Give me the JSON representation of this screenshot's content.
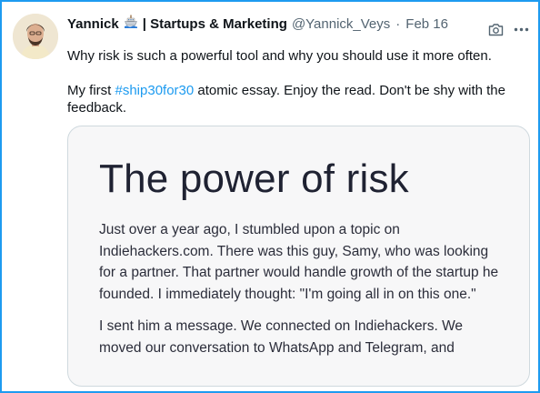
{
  "tweet": {
    "display_name": "Yannick",
    "name_suffix": "| Startups & Marketing",
    "handle": "@Yannick_Veys",
    "separator": "·",
    "date": "Feb 16",
    "text_line1": "Why risk is such a powerful tool and why you should use it more often.",
    "text2_before": "My first ",
    "hashtag": "#ship30for30",
    "text2_after": " atomic essay. Enjoy the read. Don't be shy with the feedback."
  },
  "media": {
    "title": "The power of risk",
    "paragraph1": "Just over a year ago, I stumbled upon a topic on Indiehackers.com. There was this guy, Samy, who was looking for a partner. That partner would handle growth of the startup he founded. I immediately thought: \"I'm going all in on this one.\"",
    "paragraph2": "I sent him a message. We connected on Indiehackers. We moved our conversation to WhatsApp and Telegram, and"
  },
  "colors": {
    "accent": "#1d9bf0",
    "secondary_text": "#536471",
    "primary_text": "#0f1419",
    "card_border": "#cfd9de"
  },
  "icons": {
    "name_emoji": "ship-icon",
    "actions": [
      "camera-icon",
      "more-icon"
    ]
  }
}
